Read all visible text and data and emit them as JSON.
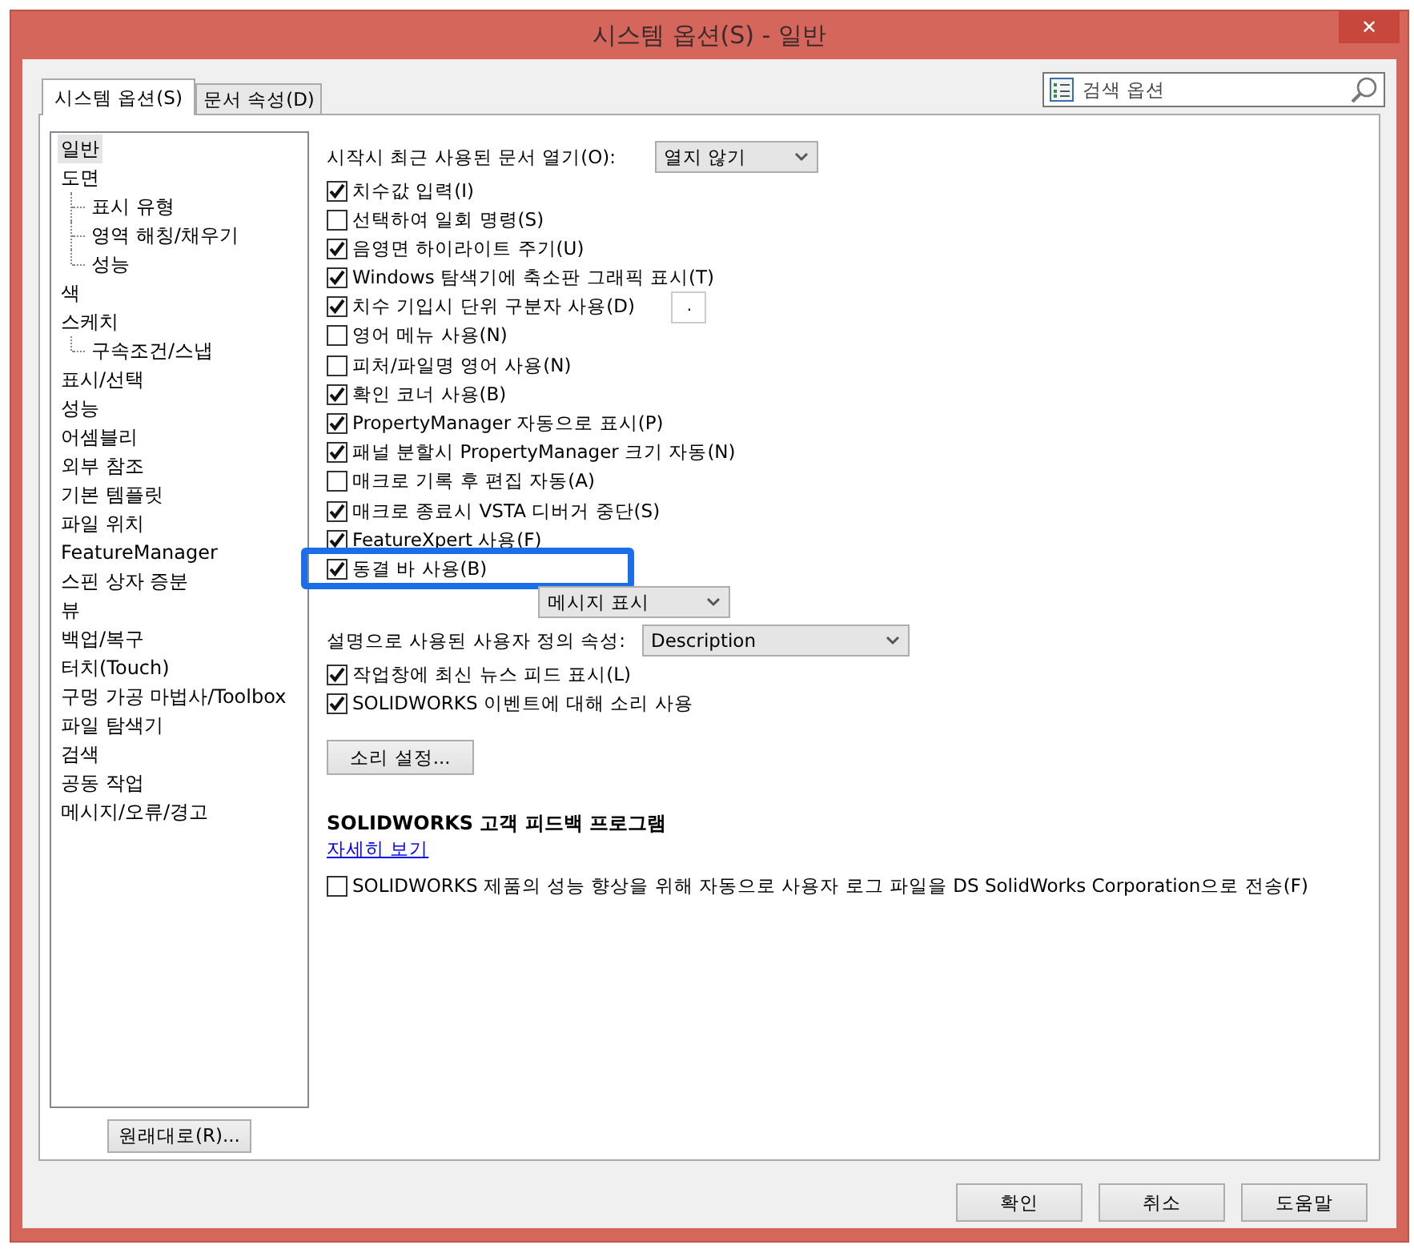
{
  "window": {
    "title": "시스템 옵션(S) - 일반",
    "close": "✕"
  },
  "tabs": [
    {
      "label": "시스템 옵션(S)",
      "selected": true
    },
    {
      "label": "문서 속성(D)",
      "selected": false
    }
  ],
  "search": {
    "placeholder": "검색 옵션"
  },
  "tree": [
    {
      "label": "일반",
      "selected": true
    },
    {
      "label": "도면",
      "selected": false,
      "children": [
        {
          "label": "표시 유형",
          "selected": false
        },
        {
          "label": "영역 해칭/채우기",
          "selected": false
        },
        {
          "label": "성능",
          "selected": false
        }
      ]
    },
    {
      "label": "색",
      "selected": false
    },
    {
      "label": "스케치",
      "selected": false,
      "children": [
        {
          "label": "구속조건/스냅",
          "selected": false
        }
      ]
    },
    {
      "label": "표시/선택",
      "selected": false
    },
    {
      "label": "성능",
      "selected": false
    },
    {
      "label": "어셈블리",
      "selected": false
    },
    {
      "label": "외부 참조",
      "selected": false
    },
    {
      "label": "기본 템플릿",
      "selected": false
    },
    {
      "label": "파일 위치",
      "selected": false
    },
    {
      "label": "FeatureManager",
      "selected": false
    },
    {
      "label": "스핀 상자 증분",
      "selected": false
    },
    {
      "label": "뷰",
      "selected": false
    },
    {
      "label": "백업/복구",
      "selected": false
    },
    {
      "label": "터치(Touch)",
      "selected": false
    },
    {
      "label": "구멍 가공 마법사/Toolbox",
      "selected": false
    },
    {
      "label": "파일 탐색기",
      "selected": false
    },
    {
      "label": "검색",
      "selected": false
    },
    {
      "label": "공동 작업",
      "selected": false
    },
    {
      "label": "메시지/오류/경고",
      "selected": false
    }
  ],
  "reset_button": "원래대로(R)...",
  "options": [
    {
      "kind": "dropdown",
      "label": "시작시 최근 사용된 문서 열기(O):",
      "value": "열지 않기",
      "highlighted": false
    },
    {
      "kind": "checkbox",
      "label": "치수값 입력(I)",
      "checked": true,
      "highlighted": false
    },
    {
      "kind": "checkbox",
      "label": "선택하여 일회 명령(S)",
      "checked": false,
      "highlighted": false
    },
    {
      "kind": "checkbox",
      "label": "음영면 하이라이트 주기(U)",
      "checked": true,
      "highlighted": false
    },
    {
      "kind": "checkbox",
      "label": "Windows 탐색기에 축소판 그래픽 표시(T)",
      "checked": true,
      "highlighted": false
    },
    {
      "kind": "checkbox",
      "label": "치수 기입시 단위 구분자 사용(D)",
      "checked": true,
      "field_value": ".",
      "highlighted": false
    },
    {
      "kind": "checkbox",
      "label": "영어 메뉴 사용(N)",
      "checked": false,
      "highlighted": false
    },
    {
      "kind": "checkbox",
      "label": "피처/파일명 영어 사용(N)",
      "checked": false,
      "highlighted": false
    },
    {
      "kind": "checkbox",
      "label": "확인 코너 사용(B)",
      "checked": true,
      "highlighted": false
    },
    {
      "kind": "checkbox",
      "label": "PropertyManager 자동으로 표시(P)",
      "checked": true,
      "highlighted": false
    },
    {
      "kind": "checkbox",
      "label": "패널 분할시 PropertyManager 크기 자동(N)",
      "checked": true,
      "highlighted": false
    },
    {
      "kind": "checkbox",
      "label": "매크로 기록 후 편집 자동(A)",
      "checked": false,
      "highlighted": false
    },
    {
      "kind": "checkbox",
      "label": "매크로 종료시 VSTA 디버거 중단(S)",
      "checked": true,
      "highlighted": false
    },
    {
      "kind": "checkbox",
      "label": "FeatureXpert 사용(F)",
      "checked": true,
      "highlighted": false
    },
    {
      "kind": "checkbox",
      "label": "동결 바 사용(B)",
      "checked": true,
      "highlighted": true
    },
    {
      "kind": "dropdown",
      "value": "메시지 표시",
      "highlighted": false
    },
    {
      "kind": "dropdown",
      "label": "설명으로 사용된 사용자 정의 속성:",
      "value": "Description",
      "highlighted": false
    },
    {
      "kind": "checkbox",
      "label": "작업창에 최신 뉴스 피드 표시(L)",
      "checked": true,
      "highlighted": false
    },
    {
      "kind": "checkbox",
      "label": "SOLIDWORKS 이벤트에 대해 소리 사용",
      "checked": true,
      "highlighted": false
    },
    {
      "kind": "button",
      "label": "소리 설정...",
      "highlighted": false
    }
  ],
  "feedback": {
    "heading": "SOLIDWORKS 고객 피드백 프로그램",
    "link": "자세히 보기",
    "option": {
      "label": "SOLIDWORKS 제품의 성능 향상을 위해 자동으로 사용자 로그 파일을 DS SolidWorks Corporation으로 전송(F)",
      "checked": false
    }
  },
  "buttons": [
    "확인",
    "취소",
    "도움말"
  ]
}
